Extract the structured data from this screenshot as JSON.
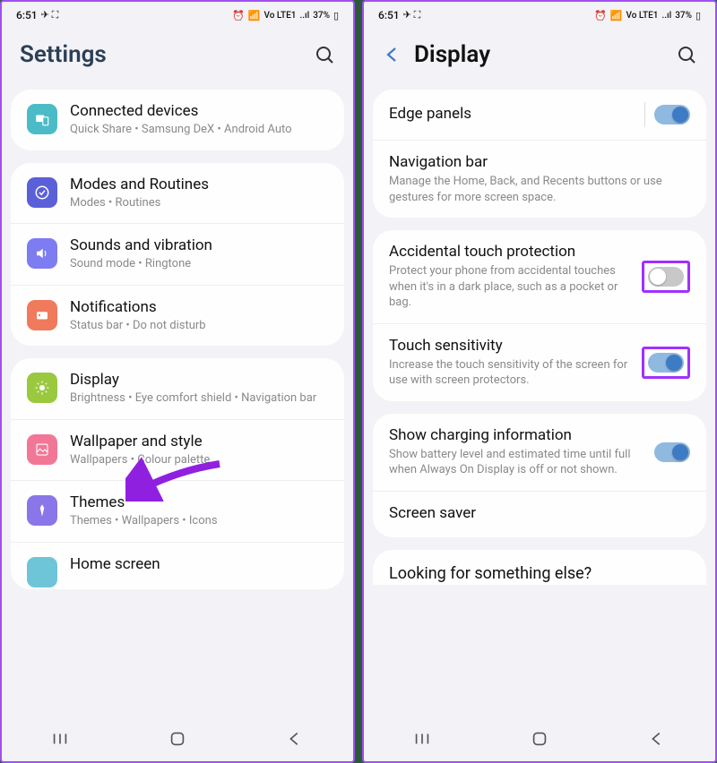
{
  "statusbar": {
    "time": "6:51",
    "battery": "37%",
    "network": "Vo LTE1",
    "signal": "..ıl"
  },
  "left": {
    "title": "Settings",
    "items": {
      "connected": {
        "title": "Connected devices",
        "sub": "Quick Share • Samsung DeX • Android Auto"
      },
      "modes": {
        "title": "Modes and Routines",
        "sub": "Modes • Routines"
      },
      "sounds": {
        "title": "Sounds and vibration",
        "sub": "Sound mode • Ringtone"
      },
      "notif": {
        "title": "Notifications",
        "sub": "Status bar • Do not disturb"
      },
      "display": {
        "title": "Display",
        "sub": "Brightness • Eye comfort shield • Navigation bar"
      },
      "wallpaper": {
        "title": "Wallpaper and style",
        "sub": "Wallpapers • Colour palette"
      },
      "themes": {
        "title": "Themes",
        "sub": "Themes • Wallpapers • Icons"
      },
      "home": {
        "title": "Home screen",
        "sub": ""
      }
    }
  },
  "right": {
    "title": "Display",
    "items": {
      "edge": {
        "title": "Edge panels",
        "toggle": true
      },
      "navbar": {
        "title": "Navigation bar",
        "sub": "Manage the Home, Back, and Recents buttons or use gestures for more screen space."
      },
      "accidental": {
        "title": "Accidental touch protection",
        "sub": "Protect your phone from accidental touches when it's in a dark place, such as a pocket or bag.",
        "toggle": false
      },
      "sensitivity": {
        "title": "Touch sensitivity",
        "sub": "Increase the touch sensitivity of the screen for use with screen protectors.",
        "toggle": true
      },
      "charging": {
        "title": "Show charging information",
        "sub": "Show battery level and estimated time until full when Always On Display is off or not shown.",
        "toggle": true
      },
      "saver": {
        "title": "Screen saver"
      }
    },
    "footer": "Looking for something else?"
  }
}
